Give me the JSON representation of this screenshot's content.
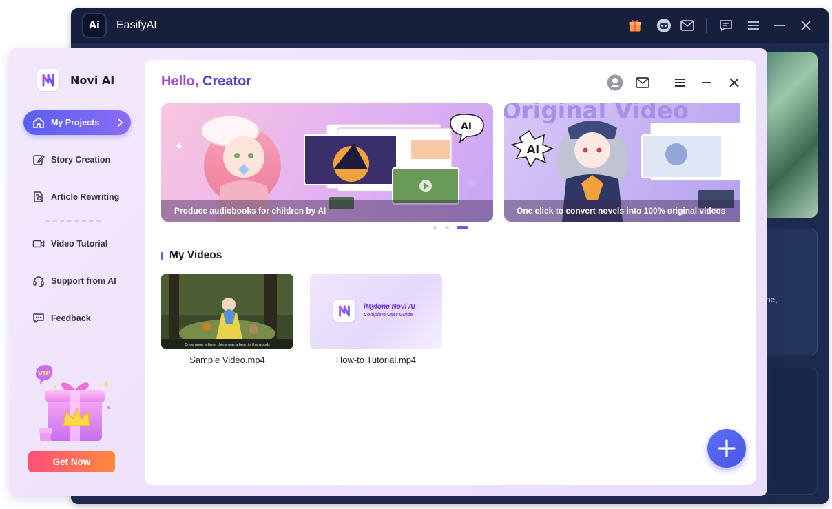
{
  "background_app": {
    "title": "EasifyAI",
    "logo_text": "Ai",
    "side_text": "ne,"
  },
  "novi": {
    "app_name": "Novi AI",
    "greeting_hello": "Hello,",
    "greeting_name": "Creator",
    "nav": [
      {
        "label": "My Projects",
        "icon": "home-icon",
        "active": true
      },
      {
        "label": "Story Creation",
        "icon": "edit-icon",
        "active": false
      },
      {
        "label": "Article Rewriting",
        "icon": "document-search-icon",
        "active": false
      },
      {
        "label": "Video Tutorial",
        "icon": "video-camera-icon",
        "active": false
      },
      {
        "label": "Support from AI",
        "icon": "headset-icon",
        "active": false
      },
      {
        "label": "Feedback",
        "icon": "chat-icon",
        "active": false
      }
    ],
    "vip_badge": "VIP",
    "get_now_label": "Get Now",
    "banners": [
      {
        "caption": "Produce audiobooks for children by AI",
        "badge": "AI"
      },
      {
        "caption": "One click to convert novels into 100% original videos",
        "badge": "AI",
        "headline": "Original Video"
      }
    ],
    "carousel": {
      "count": 3,
      "active_index": 2
    },
    "my_videos_title": "My Videos",
    "videos": [
      {
        "name": "Sample Video.mp4",
        "subtitle": "Once upon a time, there was a bear in the woods"
      },
      {
        "name": "How-to Tutorial.mp4",
        "brand": "iMyfone Novi AI",
        "guide": "Complete User Guide"
      }
    ]
  },
  "colors": {
    "accent": "#5a5ff0",
    "greeting_hello": "#a14ad8",
    "greeting_name": "#4e3fd6",
    "get_now_start": "#ff4f7a",
    "get_now_end": "#ff8a3c"
  }
}
